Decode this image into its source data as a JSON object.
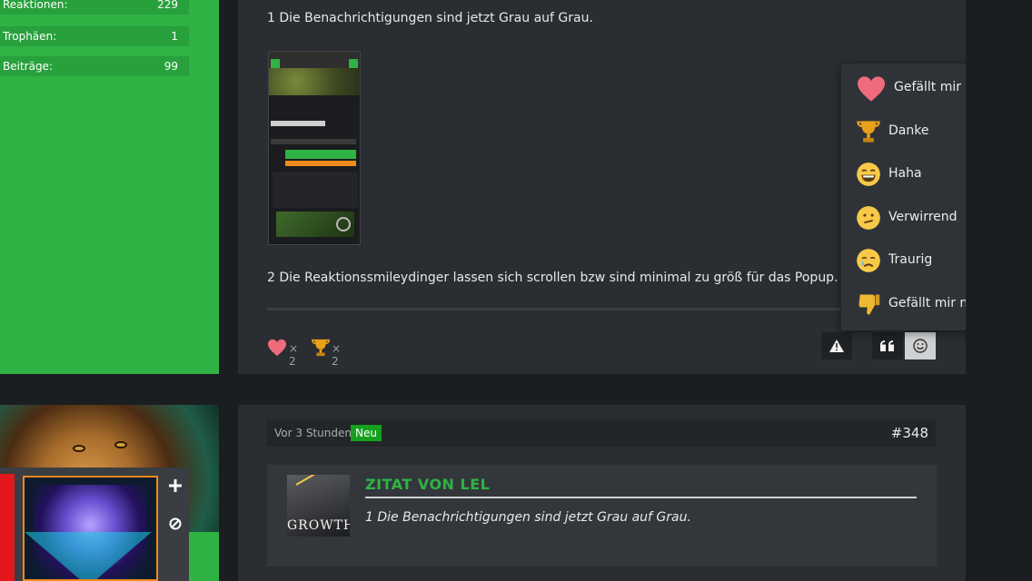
{
  "user_stats": [
    {
      "label": "Reaktionen:",
      "value": "229"
    },
    {
      "label": "Trophäen:",
      "value": "1"
    },
    {
      "label": "Beiträge:",
      "value": "99"
    }
  ],
  "post": {
    "line1": "1 Die Benachrichtigungen sind jetzt Grau auf Grau.",
    "line2": "2 Die Reaktionssmileydinger lassen sich scrollen bzw sind minimal zu größ für das Popup.",
    "reactions_summary": [
      {
        "icon": "heart-icon",
        "count": "× 2"
      },
      {
        "icon": "trophy-icon",
        "count": "× 2"
      }
    ]
  },
  "reaction_popup": [
    {
      "icon": "heart-icon",
      "label": "Gefällt mir"
    },
    {
      "icon": "trophy-icon",
      "label": "Danke"
    },
    {
      "icon": "grin-icon",
      "label": "Haha"
    },
    {
      "icon": "confused-icon",
      "label": "Verwirrend"
    },
    {
      "icon": "sad-icon",
      "label": "Traurig"
    },
    {
      "icon": "thumbs-down-icon",
      "label": "Gefällt mir nicht"
    }
  ],
  "post2": {
    "time": "Vor 3 Stunden",
    "badge": "Neu",
    "number": "#348",
    "quote_title": "ZITAT VON LEL",
    "quote_text": "1 Die Benachrichtigungen sind jetzt Grau auf Grau.",
    "quote_image_text": "GROWTH"
  },
  "colors": {
    "accent": "#2fb344",
    "new_badge": "#14a01c",
    "card_bg": "#2a2d31",
    "page_bg": "#1b1e21"
  }
}
